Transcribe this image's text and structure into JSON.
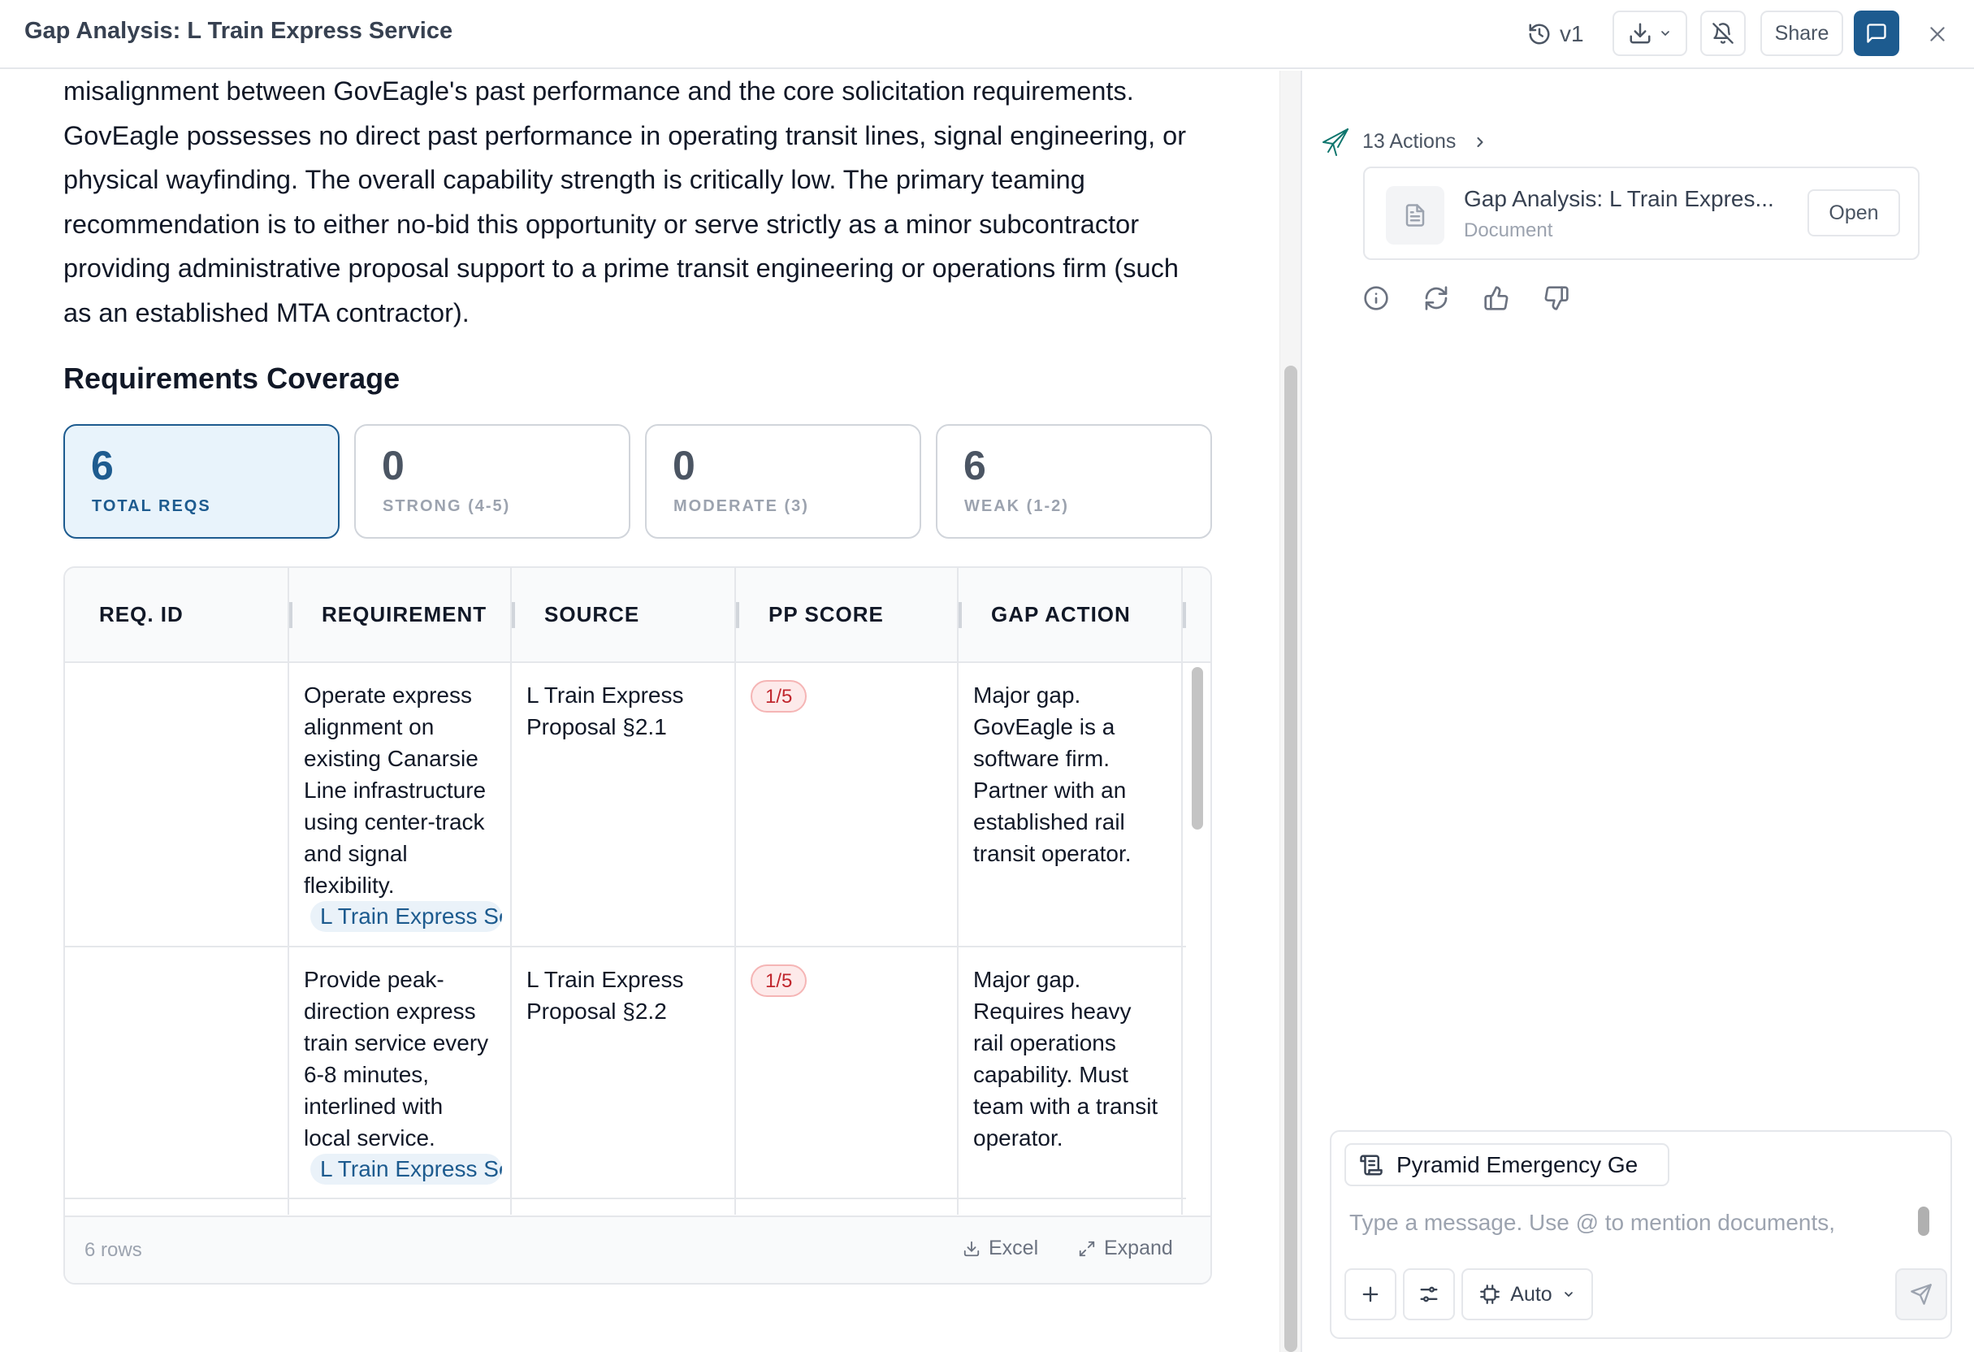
{
  "header": {
    "title": "Gap Analysis: L Train Express Service",
    "version": "v1",
    "share_label": "Share"
  },
  "document": {
    "summary_lines": [
      "misalignment between GovEagle's past performance and the core solicitation requirements.",
      "GovEagle possesses no direct past performance in operating transit lines, signal engineering, or",
      "physical wayfinding. The overall capability strength is critically low. The primary teaming",
      "recommendation is to either no-bid this opportunity or serve strictly as a minor subcontractor",
      "providing administrative proposal support to a prime transit engineering or operations firm (such",
      "as an established MTA contractor)."
    ],
    "section_heading": "Requirements Coverage",
    "stats": [
      {
        "value": "6",
        "label": "TOTAL REQS",
        "active": true
      },
      {
        "value": "0",
        "label": "STRONG (4-5)",
        "active": false
      },
      {
        "value": "0",
        "label": "MODERATE (3)",
        "active": false
      },
      {
        "value": "6",
        "label": "WEAK (1-2)",
        "active": false
      }
    ],
    "table": {
      "columns": [
        "REQ. ID",
        "REQUIREMENT",
        "SOURCE",
        "PP SCORE",
        "GAP ACTION"
      ],
      "rows": [
        {
          "req_id": "",
          "requirement": "Operate express alignment on existing Canarsie Line infrastructure using center-track and signal flexibility.",
          "source_chip": "L Train Express Service",
          "source": "L Train Express Proposal §2.1",
          "score": "1/5",
          "gap_action": "Major gap. GovEagle is a software firm. Partner with an established rail transit operator."
        },
        {
          "req_id": "",
          "requirement": "Provide peak-direction express train service every 6-8 minutes, interlined with local service.",
          "source_chip": "L Train Express Service",
          "source": "L Train Express Proposal §2.2",
          "score": "1/5",
          "gap_action": "Major gap. Requires heavy rail operations capability. Must team with a transit operator."
        }
      ],
      "footer": {
        "rows_count": "6 rows",
        "excel_label": "Excel",
        "expand_label": "Expand"
      }
    }
  },
  "assistant": {
    "actions_label": "13 Actions",
    "doc_card": {
      "title": "Gap Analysis: L Train Expres...",
      "subtitle": "Document",
      "open_label": "Open"
    },
    "composer": {
      "context_chip": "Pyramid Emergency Ge",
      "placeholder": "Type a message. Use @ to mention documents,",
      "value": "",
      "model_label": "Auto"
    }
  },
  "colors": {
    "accent": "#1d5b8f",
    "score_bad": "#c0262d",
    "border": "#e5e7eb"
  }
}
